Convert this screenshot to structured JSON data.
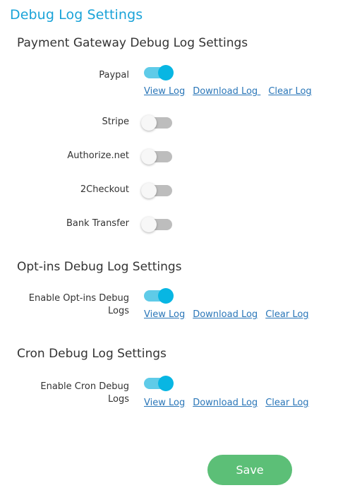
{
  "page_title": "Debug Log Settings",
  "payment": {
    "heading": "Payment Gateway Debug Log Settings",
    "gateways": [
      {
        "label": "Paypal",
        "enabled": true
      },
      {
        "label": "Stripe",
        "enabled": false
      },
      {
        "label": "Authorize.net",
        "enabled": false
      },
      {
        "label": "2Checkout",
        "enabled": false
      },
      {
        "label": "Bank Transfer",
        "enabled": false
      }
    ],
    "links": {
      "view": "View Log",
      "download": "Download Log ",
      "clear": "Clear Log"
    }
  },
  "optins": {
    "heading": "Opt-ins Debug Log Settings",
    "label_line1": "Enable Opt-ins Debug",
    "label_line2": "Logs",
    "enabled": true,
    "links": {
      "view": "View Log",
      "download": "Download Log",
      "clear": "Clear Log"
    }
  },
  "cron": {
    "heading": "Cron Debug Log Settings",
    "label_line1": "Enable Cron Debug",
    "label_line2": "Logs",
    "enabled": true,
    "links": {
      "view": "View Log",
      "download": "Download Log",
      "clear": "Clear Log"
    }
  },
  "save_label": "Save",
  "colors": {
    "title": "#1aa3d8",
    "toggle_on_track": "#5fcbe8",
    "toggle_on_knob": "#08b6e3",
    "toggle_off_track": "#bdbdbd",
    "link": "#2a76b8",
    "save_button": "#5cbf77"
  }
}
